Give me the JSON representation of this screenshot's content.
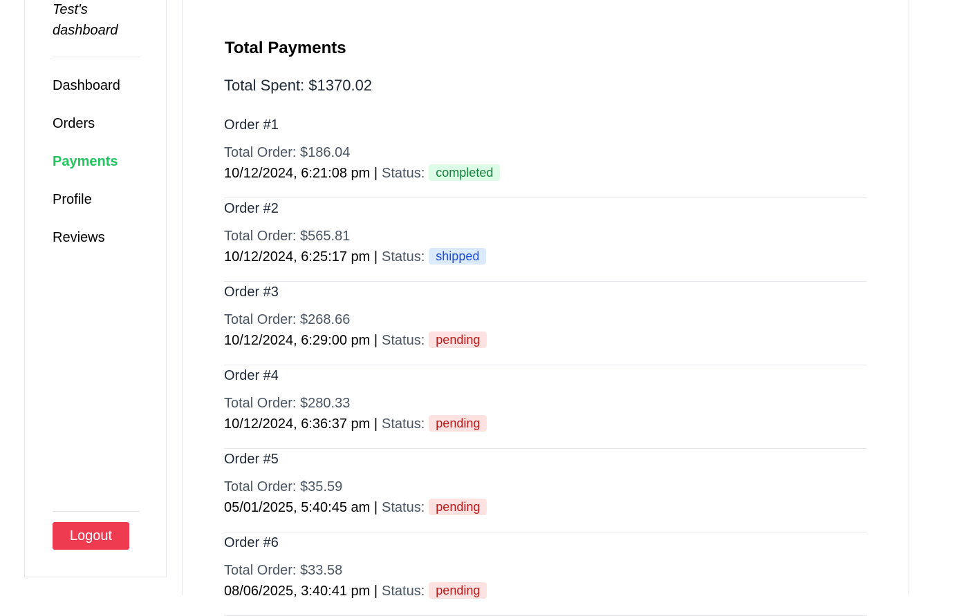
{
  "sidebar": {
    "brand": "Test's dashboard",
    "items": [
      {
        "label": "Dashboard",
        "active": false
      },
      {
        "label": "Orders",
        "active": false
      },
      {
        "label": "Payments",
        "active": true
      },
      {
        "label": "Profile",
        "active": false
      },
      {
        "label": "Reviews",
        "active": false
      }
    ],
    "logout_label": "Logout"
  },
  "main": {
    "title": "Total Payments",
    "total_spent": "Total Spent: $1370.02",
    "status_label": "Status:",
    "orders": [
      {
        "title": "Order #1",
        "total": "Total Order: $186.04",
        "datetime": "10/12/2024, 6:21:08 pm |",
        "status": "completed"
      },
      {
        "title": "Order #2",
        "total": "Total Order: $565.81",
        "datetime": "10/12/2024, 6:25:17 pm |",
        "status": "shipped"
      },
      {
        "title": "Order #3",
        "total": "Total Order: $268.66",
        "datetime": "10/12/2024, 6:29:00 pm |",
        "status": "pending"
      },
      {
        "title": "Order #4",
        "total": "Total Order: $280.33",
        "datetime": "10/12/2024, 6:36:37 pm |",
        "status": "pending"
      },
      {
        "title": "Order #5",
        "total": "Total Order: $35.59",
        "datetime": "05/01/2025, 5:40:45 am |",
        "status": "pending"
      },
      {
        "title": "Order #6",
        "total": "Total Order: $33.58",
        "datetime": "08/06/2025, 3:40:41 pm |",
        "status": "pending"
      }
    ]
  },
  "colors": {
    "accent_active": "#22c55e",
    "logout_bg": "#ef3b4f",
    "completed_bg": "#dcfce7",
    "shipped_bg": "#dbeafe",
    "pending_bg": "#fee2e2"
  }
}
